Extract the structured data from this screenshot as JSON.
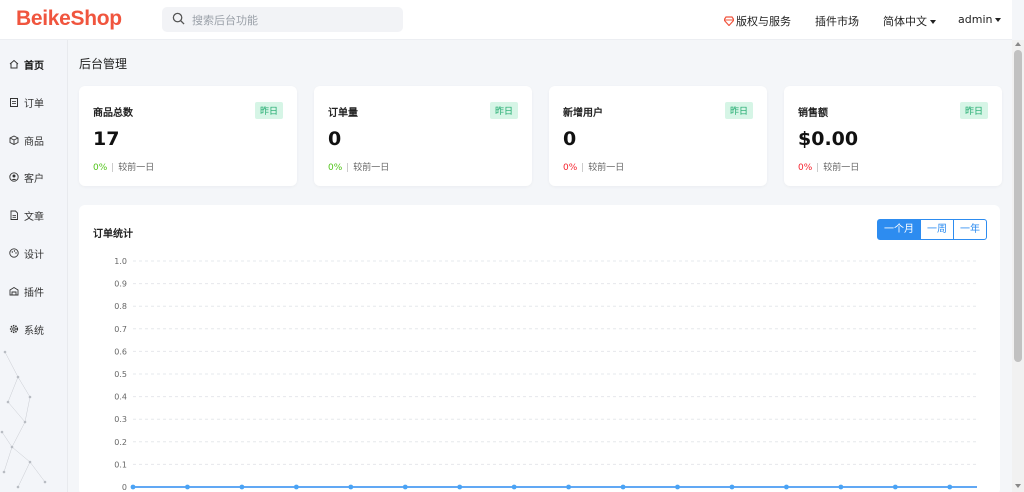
{
  "header": {
    "logo": "BeikeShop",
    "search_placeholder": "搜索后台功能",
    "license": "版权与服务",
    "plugin_market": "插件市场",
    "language": "简体中文",
    "user": "admin"
  },
  "sidebar": {
    "items": [
      {
        "label": "首页",
        "icon": "home-icon",
        "active": true
      },
      {
        "label": "订单",
        "icon": "clipboard-icon",
        "active": false
      },
      {
        "label": "商品",
        "icon": "box-icon",
        "active": false
      },
      {
        "label": "客户",
        "icon": "user-circle-icon",
        "active": false
      },
      {
        "label": "文章",
        "icon": "document-icon",
        "active": false
      },
      {
        "label": "设计",
        "icon": "palette-icon",
        "active": false
      },
      {
        "label": "插件",
        "icon": "plugin-icon",
        "active": false
      },
      {
        "label": "系统",
        "icon": "gear-icon",
        "active": false
      }
    ]
  },
  "page_title": "后台管理",
  "cards": [
    {
      "title": "商品总数",
      "badge": "昨日",
      "value": "17",
      "pct": "0%",
      "pct_color": "#52c41a",
      "compare": "较前一日"
    },
    {
      "title": "订单量",
      "badge": "昨日",
      "value": "0",
      "pct": "0%",
      "pct_color": "#52c41a",
      "compare": "较前一日"
    },
    {
      "title": "新增用户",
      "badge": "昨日",
      "value": "0",
      "pct": "0%",
      "pct_color": "#f5222d",
      "compare": "较前一日"
    },
    {
      "title": "销售额",
      "badge": "昨日",
      "value": "$0.00",
      "pct": "0%",
      "pct_color": "#f5222d",
      "compare": "较前一日"
    }
  ],
  "order_chart": {
    "title": "订单统计",
    "ranges": [
      "一个月",
      "一周",
      "一年"
    ],
    "active_range": "一个月"
  },
  "chart_data": {
    "type": "line",
    "title": "订单统计",
    "xlabel": "",
    "ylabel": "",
    "ylim": [
      0,
      1.0
    ],
    "yticks": [
      "0",
      "0.1",
      "0.2",
      "0.3",
      "0.4",
      "0.5",
      "0.6",
      "0.7",
      "0.8",
      "0.9",
      "1.0"
    ],
    "grid": true,
    "line_color": "#2d8cf0",
    "point_color": "#4aa3f5",
    "series": [
      {
        "values": [
          0,
          0,
          0,
          0,
          0,
          0,
          0,
          0,
          0,
          0,
          0,
          0,
          0,
          0,
          0,
          0,
          0,
          0,
          0,
          0,
          0,
          0,
          0,
          0,
          0,
          0,
          0,
          0,
          0,
          0,
          0,
          0
        ]
      }
    ]
  },
  "colors": {
    "brand": "#f0553e",
    "accent": "#2d8cf0",
    "badge_bg": "#d6f5e6",
    "badge_text": "#1aa86a"
  }
}
